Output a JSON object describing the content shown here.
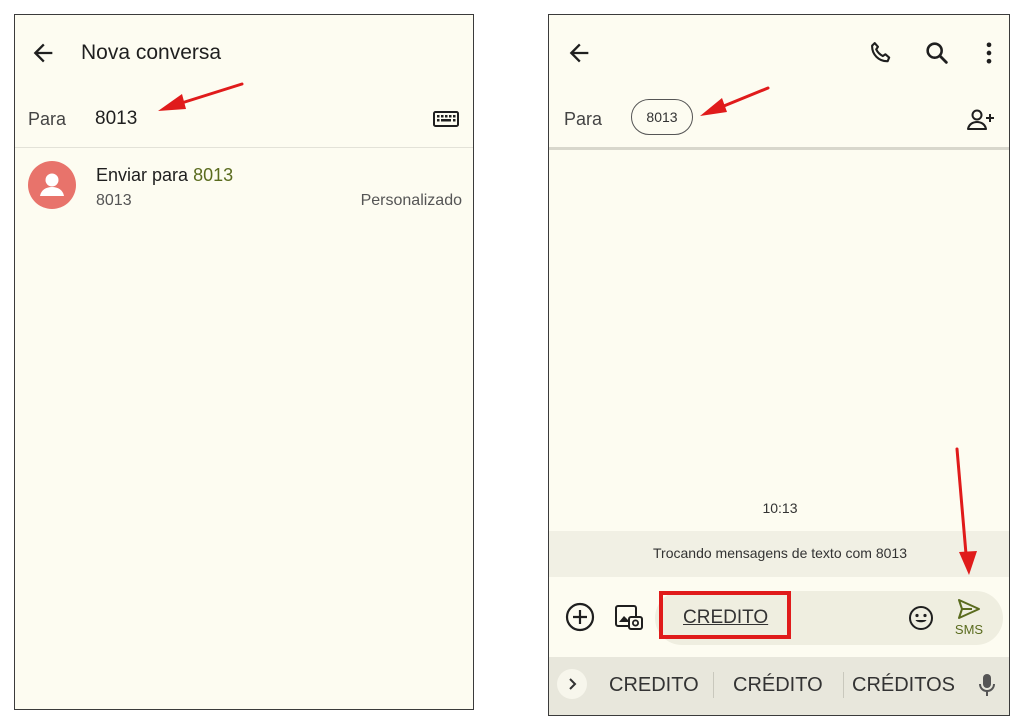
{
  "left": {
    "header": {
      "title": "Nova conversa"
    },
    "to": {
      "label": "Para",
      "value": "8013"
    },
    "suggestion": {
      "prefix": "Enviar para",
      "number": "8013",
      "subtitle": "8013",
      "type": "Personalizado"
    }
  },
  "right": {
    "to": {
      "label": "Para",
      "chip": "8013"
    },
    "timestamp": "10:13",
    "info_banner": "Trocando mensagens de texto com 8013",
    "composer": {
      "text": "CREDITO",
      "send_label": "SMS"
    },
    "keyboard_suggestions": [
      "CREDITO",
      "CRÉDITO",
      "CRÉDITOS"
    ]
  },
  "colors": {
    "background": "#fdfcf1",
    "avatar": "#e8736b",
    "highlight_number": "#5a6b1e",
    "send": "#5a6b1e",
    "annotation": "#e01b1b"
  },
  "icons": [
    "back-arrow-icon",
    "keyboard-icon",
    "person-icon",
    "phone-icon",
    "search-icon",
    "more-vert-icon",
    "add-contact-icon",
    "add-circle-icon",
    "gallery-icon",
    "emoji-icon",
    "send-icon",
    "chevron-right-icon",
    "mic-icon"
  ]
}
